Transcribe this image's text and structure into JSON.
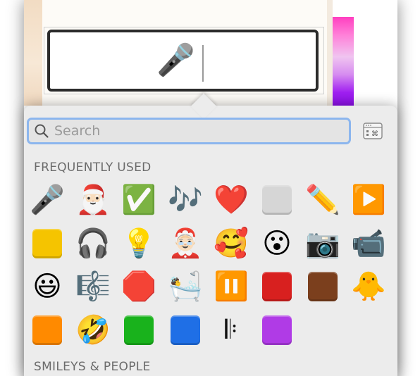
{
  "document": {
    "inserted_emoji": "🎤",
    "gradient_colors": [
      "#ff3fbf",
      "#f0c4f0",
      "#a020f0"
    ]
  },
  "picker": {
    "search": {
      "placeholder": "Search",
      "value": ""
    },
    "categories_icon": "category-grid-icon",
    "accent_color": "#8cb6ee",
    "sections": {
      "frequently_used": "FREQUENTLY USED",
      "smileys_people": "SMILEYS & PEOPLE"
    },
    "emoji_rows": [
      [
        "🎤",
        "🎅🏻",
        "✅",
        "🎶",
        "❤️",
        "⬜",
        "✏️",
        "▶️"
      ],
      [
        "🟨",
        "🎧",
        "💡",
        "🤶🏻",
        "🥰",
        "😮",
        "📷",
        "📹"
      ],
      [
        "😃",
        "🎼",
        "🛑",
        "🛀",
        "⏸️",
        "🟥",
        "🟫",
        "🐥"
      ],
      [
        "🟧",
        "🤣",
        "🟩",
        "🟦",
        "𝄆",
        "🟪"
      ]
    ],
    "square_colors": {
      "⬜": "#d6d6d6",
      "🟨": "#f5c400",
      "🟥": "#d8201f",
      "🟫": "#7b3f1d",
      "🟧": "#ff8a00",
      "🟩": "#19b21c",
      "🟦": "#1f6fe6",
      "🟪": "#b03be6"
    }
  }
}
